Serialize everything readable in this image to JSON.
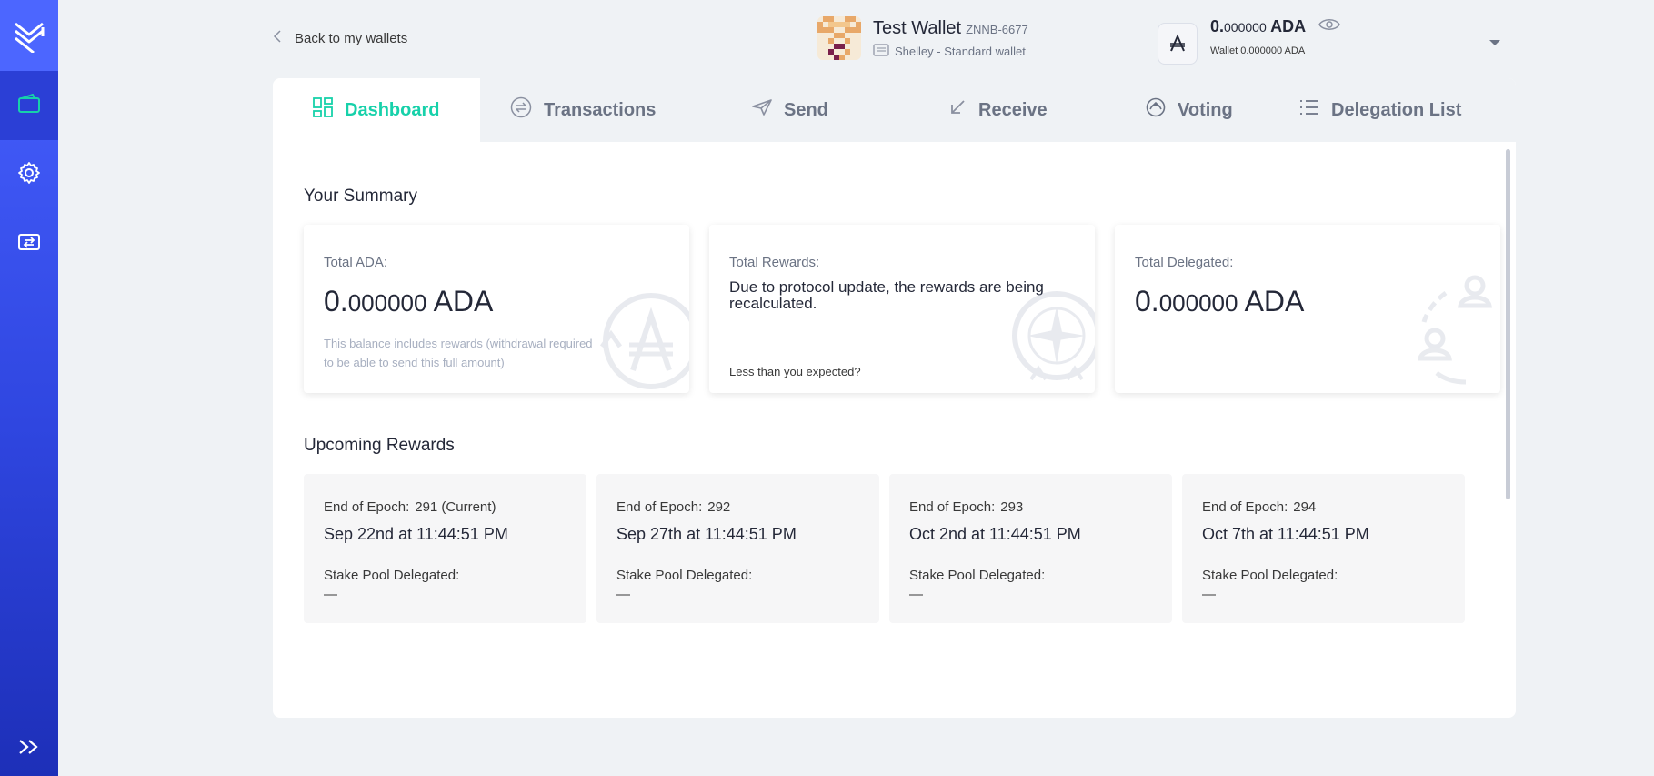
{
  "sidebar": {
    "logo_icon": "yoroi-logo-icon",
    "items": [
      {
        "icon": "wallet-icon",
        "active": true
      },
      {
        "icon": "gear-icon",
        "active": false
      },
      {
        "icon": "transfer-icon",
        "active": false
      }
    ],
    "expand_icon": "double-chevron-right-icon"
  },
  "header": {
    "back_label": "Back to my wallets",
    "wallet_name": "Test Wallet",
    "wallet_plate": "ZNNB-6677",
    "wallet_type": "Shelley - Standard wallet",
    "balance_int": "0.",
    "balance_dec": "000000",
    "balance_unit": "ADA",
    "wallet_balance_prefix": "Wallet",
    "wallet_balance_value": "0.000000 ADA"
  },
  "tabs": [
    {
      "label": "Dashboard",
      "icon": "dashboard-icon",
      "active": true
    },
    {
      "label": "Transactions",
      "icon": "transactions-icon",
      "active": false
    },
    {
      "label": "Send",
      "icon": "send-icon",
      "active": false
    },
    {
      "label": "Receive",
      "icon": "receive-icon",
      "active": false
    },
    {
      "label": "Voting",
      "icon": "voting-icon",
      "active": false
    },
    {
      "label": "Delegation List",
      "icon": "list-icon",
      "active": false
    }
  ],
  "summary": {
    "title": "Your Summary",
    "total_ada": {
      "label": "Total ADA:",
      "value_int": "0.",
      "value_dec": "000000",
      "unit": "ADA",
      "note": "This balance includes rewards (withdrawal required to be able to send this full amount)"
    },
    "total_rewards": {
      "label": "Total Rewards:",
      "message": "Due to protocol update, the rewards are being recalculated.",
      "link": "Less than you expected?"
    },
    "total_delegated": {
      "label": "Total Delegated:",
      "value_int": "0.",
      "value_dec": "000000",
      "unit": "ADA"
    }
  },
  "upcoming": {
    "title": "Upcoming Rewards",
    "epoch_label": "End of Epoch:",
    "pool_label": "Stake Pool Delegated:",
    "items": [
      {
        "epoch": "291 (Current)",
        "date": "Sep 22nd at 11:44:51 PM",
        "pool": "—"
      },
      {
        "epoch": "292",
        "date": "Sep 27th at 11:44:51 PM",
        "pool": "—"
      },
      {
        "epoch": "293",
        "date": "Oct 2nd at 11:44:51 PM",
        "pool": "—"
      },
      {
        "epoch": "294",
        "date": "Oct 7th at 11:44:51 PM",
        "pool": "—"
      }
    ]
  },
  "colors": {
    "accent": "#17d1aa",
    "sidebar": "#3149e6",
    "text": "#242838",
    "muted": "#6b7384"
  }
}
